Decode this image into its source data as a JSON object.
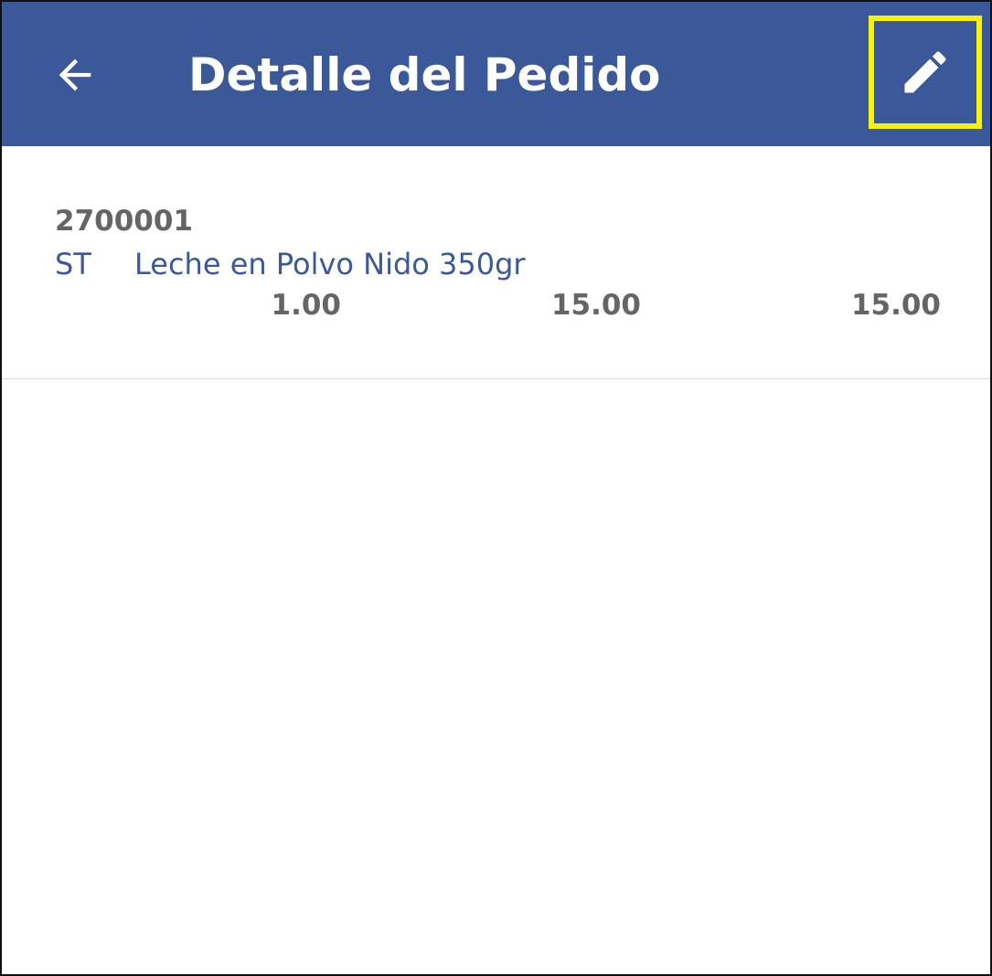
{
  "app_bar": {
    "title": "Detalle del Pedido",
    "back_icon": "arrow-left-icon",
    "edit_icon": "pencil-icon",
    "background_color": "#3b5998",
    "highlight_color": "#f6f20a"
  },
  "order_items": [
    {
      "code": "2700001",
      "unit": "ST",
      "name": "Leche en Polvo Nido 350gr",
      "quantity": "1.00",
      "unit_price": "15.00",
      "total": "15.00"
    }
  ]
}
